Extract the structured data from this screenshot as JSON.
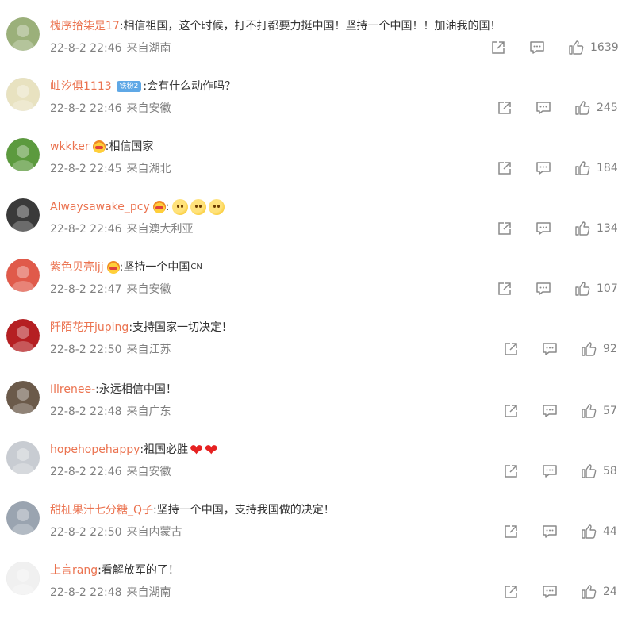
{
  "comments": [
    {
      "user": "槐序拾柒是17",
      "badge": "",
      "crown": false,
      "emoji_count": 0,
      "hearts": 0,
      "text": ":相信祖国，这个时候，打不打都要力挺中国！坚持一个中国！！加油我的国！",
      "suffix": "",
      "time": "22-8-2 22:46",
      "location": "来自湖南",
      "likes": "1639",
      "avatar_color": "#9bb07a"
    },
    {
      "user": "屾汐俱1113",
      "badge": "铁粉2",
      "crown": false,
      "emoji_count": 0,
      "hearts": 0,
      "text": ":会有什么动作吗？",
      "suffix": "",
      "time": "22-8-2 22:46",
      "location": "来自安徽",
      "likes": "245",
      "avatar_color": "#e8e2c0"
    },
    {
      "user": "wkkker",
      "badge": "",
      "crown": true,
      "emoji_count": 0,
      "hearts": 0,
      "text": ":相信国家",
      "suffix": "",
      "time": "22-8-2 22:45",
      "location": "来自湖北",
      "likes": "184",
      "avatar_color": "#5c9a3e"
    },
    {
      "user": "Alwaysawake_pcy",
      "badge": "",
      "crown": true,
      "emoji_count": 3,
      "hearts": 0,
      "text": ":",
      "suffix": "",
      "time": "22-8-2 22:46",
      "location": "来自澳大利亚",
      "likes": "134",
      "avatar_color": "#3a3a3a"
    },
    {
      "user": "紫色贝壳ljj",
      "badge": "",
      "crown": true,
      "emoji_count": 0,
      "hearts": 0,
      "text": ":坚持一个中国",
      "suffix": "CN",
      "time": "22-8-2 22:47",
      "location": "来自安徽",
      "likes": "107",
      "avatar_color": "#e05a4a"
    },
    {
      "user": "阡陌花开juping",
      "badge": "",
      "crown": false,
      "emoji_count": 0,
      "hearts": 0,
      "text": ":支持国家一切决定！",
      "suffix": "",
      "time": "22-8-2 22:50",
      "location": "来自江苏",
      "likes": "92",
      "avatar_color": "#b51f22"
    },
    {
      "user": "Illrenee-",
      "badge": "",
      "crown": false,
      "emoji_count": 0,
      "hearts": 0,
      "text": ":永远相信中国！",
      "suffix": "",
      "time": "22-8-2 22:48",
      "location": "来自广东",
      "likes": "57",
      "avatar_color": "#6b5a4a"
    },
    {
      "user": "hopehopehappy",
      "badge": "",
      "crown": false,
      "emoji_count": 0,
      "hearts": 2,
      "text": ":祖国必胜",
      "suffix": "",
      "time": "22-8-2 22:46",
      "location": "来自安徽",
      "likes": "58",
      "avatar_color": "#c8ccd2"
    },
    {
      "user": "甜柾果汁七分糖_Q子",
      "badge": "",
      "crown": false,
      "emoji_count": 0,
      "hearts": 0,
      "text": ":坚持一个中国，支持我国做的决定！",
      "suffix": "",
      "time": "22-8-2 22:50",
      "location": "来自内蒙古",
      "likes": "44",
      "avatar_color": "#9aa4b0"
    },
    {
      "user": "上言rang",
      "badge": "",
      "crown": false,
      "emoji_count": 0,
      "hearts": 0,
      "text": ":看解放军的了！",
      "suffix": "",
      "time": "22-8-2 22:48",
      "location": "来自湖南",
      "likes": "24",
      "avatar_color": "#f0f0f0"
    }
  ],
  "icons": {
    "share": "share-icon",
    "comment": "comment-icon",
    "like": "like-icon"
  },
  "colors": {
    "username": "#eb7350",
    "meta": "#808080",
    "text": "#333333",
    "badge": "#5fa8e6"
  }
}
